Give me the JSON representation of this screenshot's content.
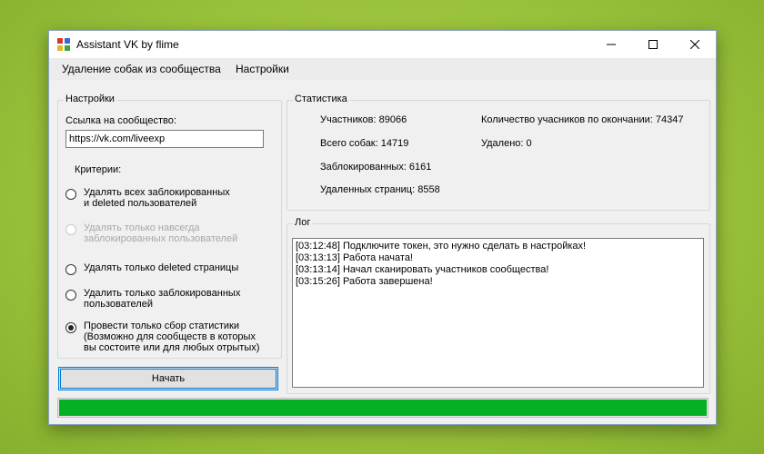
{
  "window": {
    "title": "Assistant VK by flime"
  },
  "menu": {
    "items": [
      {
        "label": "Удаление собак из сообщества"
      },
      {
        "label": "Настройки"
      }
    ]
  },
  "settings": {
    "group_title": "Настройки",
    "community_link_label": "Ссылка на сообщество:",
    "community_link_value": "https://vk.com/liveexp",
    "criteria_label": "Критерии:",
    "options": [
      {
        "label": "Удалять всех заблокированных\nи deleted пользователей",
        "checked": false,
        "enabled": true
      },
      {
        "label": "Удалять только навсегда\nзаблокированных пользователей",
        "checked": false,
        "enabled": false
      },
      {
        "label": "Удалять только deleted страницы",
        "checked": false,
        "enabled": true
      },
      {
        "label": "Удалить только заблокированных\nпользователей",
        "checked": false,
        "enabled": true
      },
      {
        "label": "Провести только сбор статистики\n(Возможно для сообществ в которых\nвы состоите или для любых отрытых)",
        "checked": true,
        "enabled": true
      }
    ],
    "start_button": "Начать"
  },
  "stats": {
    "group_title": "Статистика",
    "members": "Участников: 89066",
    "total_dogs": "Всего собак: 14719",
    "blocked": "Заблокированных: 6161",
    "deleted_pages": "Удаленных страниц: 8558",
    "members_after": "Количество учасников по окончании: 74347",
    "removed": "Удалено: 0"
  },
  "log": {
    "group_title": "Лог",
    "lines": [
      "[03:12:48] Подключите токен, это нужно сделать в настройках!",
      "[03:13:13] Работа начата!",
      "[03:13:14] Начал сканировать участников сообщества!",
      "[03:15:26] Работа завершена!"
    ]
  },
  "progress": {
    "fraction": 1.0,
    "color": "#06b025"
  },
  "icons": {
    "app": "app-icon",
    "minimize": "minimize-icon",
    "maximize": "maximize-icon",
    "close": "close-icon"
  }
}
